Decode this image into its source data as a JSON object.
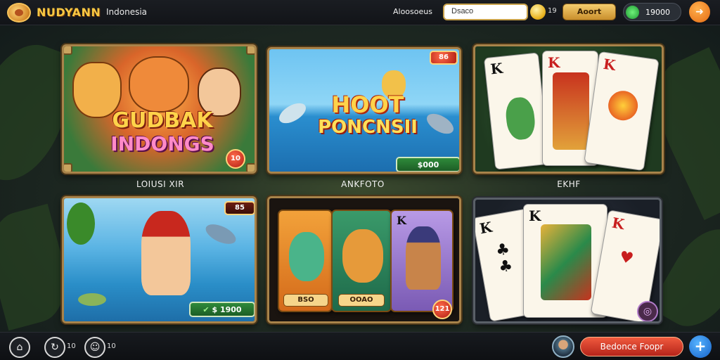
{
  "header": {
    "brand": "NUDYANN",
    "brand_sub": "Indonesia",
    "label": "Aloosoeus",
    "search_value": "Dsaco",
    "coin_count": "19",
    "gold_button": "Aoort",
    "balance": "19000",
    "menu_icon": "arrow-icon"
  },
  "tiles": [
    {
      "title_line1": "GUDBAK",
      "title_line2": "INDONGS",
      "badge": "10",
      "label": "LOIUSI XIR"
    },
    {
      "title_line1": "HOOT",
      "title_line2": "PONCNSII",
      "price": "$000",
      "badge": "86",
      "label": "ANKFOTO"
    },
    {
      "label": "EKHF",
      "card1": "K",
      "card2": "K",
      "card3": "K"
    },
    {
      "badge": "85",
      "price": "1900",
      "price_prefix": "$"
    },
    {
      "card_a": "BSO",
      "card_b": "OOAO",
      "card_c": "K",
      "badge": "121"
    },
    {
      "card1": "K",
      "card2": "K",
      "card3": "K"
    }
  ],
  "footer": {
    "count1": "10",
    "count2": "10",
    "action_button": "Bedonce Foopr",
    "plus_label": "+"
  },
  "colors": {
    "gold": "#f7c843",
    "red_button": "#d6382a",
    "blue_button": "#2a7de0",
    "green_tag": "#2f8a3a"
  }
}
